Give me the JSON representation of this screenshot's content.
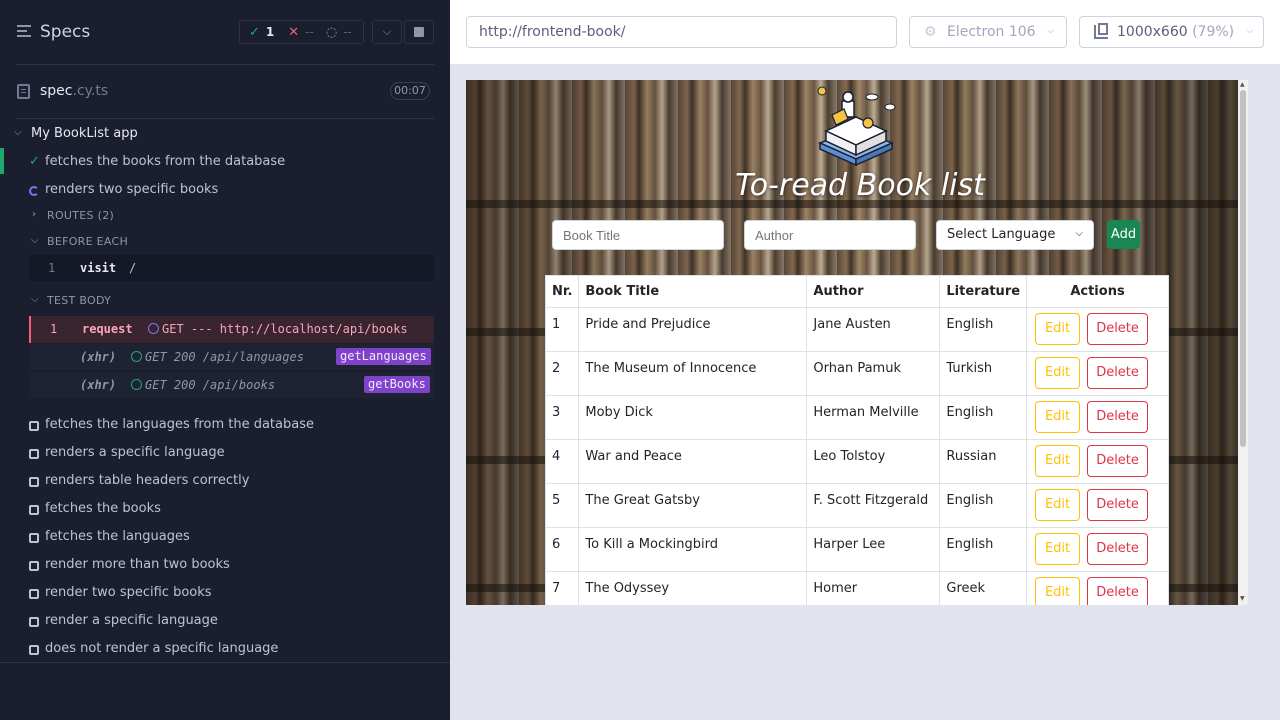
{
  "reporter": {
    "title": "Specs",
    "stats": {
      "passed": "1",
      "failed": "--",
      "pending": "--"
    },
    "spec": {
      "name": "spec",
      "ext": ".cy.ts",
      "duration": "00:07"
    },
    "suite": "My BookList app",
    "tests_done": [
      {
        "label": "fetches the books from the database",
        "state": "passed"
      },
      {
        "label": "renders two specific books",
        "state": "running"
      }
    ],
    "routes_label": "ROUTES (2)",
    "before_each_label": "BEFORE EACH",
    "before_each_cmd": {
      "num": "1",
      "name": "visit",
      "msg": "/"
    },
    "test_body_label": "TEST BODY",
    "request_cmd": {
      "num": "1",
      "name": "request",
      "msg": "GET --- http://localhost/api/books"
    },
    "xhr_rows": [
      {
        "name": "(xhr)",
        "msg": "GET 200 /api/languages",
        "alias": "getLanguages"
      },
      {
        "name": "(xhr)",
        "msg": "GET 200 /api/books",
        "alias": "getBooks"
      }
    ],
    "pending_tests": [
      "fetches the languages from the database",
      "renders a specific language",
      "renders table headers correctly",
      "fetches the books",
      "fetches the languages",
      "render more than two books",
      "render two specific books",
      "render a specific language",
      "does not render a specific language"
    ]
  },
  "preview": {
    "url": "http://frontend-book/",
    "browser": "Electron 106",
    "viewport": "1000x660",
    "scale": "(79%)"
  },
  "app": {
    "title": "To-read Book list",
    "inputs": {
      "title_placeholder": "Book Title",
      "author_placeholder": "Author",
      "language_select": "Select Language",
      "add": "Add"
    },
    "headers": [
      "Nr.",
      "Book Title",
      "Author",
      "Literature",
      "Actions"
    ],
    "edit_label": "Edit",
    "delete_label": "Delete",
    "books": [
      {
        "nr": "1",
        "title": "Pride and Prejudice",
        "author": "Jane Austen",
        "lit": "English"
      },
      {
        "nr": "2",
        "title": "The Museum of Innocence",
        "author": "Orhan Pamuk",
        "lit": "Turkish"
      },
      {
        "nr": "3",
        "title": "Moby Dick",
        "author": "Herman Melville",
        "lit": "English"
      },
      {
        "nr": "4",
        "title": "War and Peace",
        "author": "Leo Tolstoy",
        "lit": "Russian"
      },
      {
        "nr": "5",
        "title": "The Great Gatsby",
        "author": "F. Scott Fitzgerald",
        "lit": "English"
      },
      {
        "nr": "6",
        "title": "To Kill a Mockingbird",
        "author": "Harper Lee",
        "lit": "English"
      },
      {
        "nr": "7",
        "title": "The Odyssey",
        "author": "Homer",
        "lit": "Greek"
      }
    ]
  },
  "colors": {
    "pass": "#1fa971",
    "fail": "#f15f7b",
    "running": "#6f7bf7",
    "alias": "#7f43c9",
    "add_button": "#198754",
    "edit": "#ffc107",
    "delete": "#dc3545"
  }
}
